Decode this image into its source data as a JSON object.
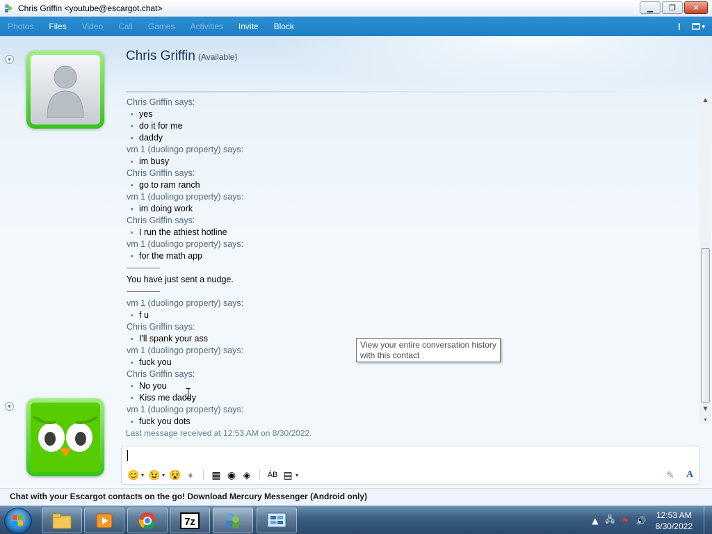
{
  "window": {
    "title": "Chris Griffin <youtube@escargot.chat>",
    "minimize_glyph": "▁",
    "maximize_glyph": "❐",
    "close_glyph": "✕"
  },
  "menu": {
    "items": [
      {
        "label": "Photos",
        "enabled": false
      },
      {
        "label": "Files",
        "enabled": true
      },
      {
        "label": "Video",
        "enabled": false
      },
      {
        "label": "Call",
        "enabled": false
      },
      {
        "label": "Games",
        "enabled": false
      },
      {
        "label": "Activities",
        "enabled": false
      },
      {
        "label": "Invite",
        "enabled": true
      },
      {
        "label": "Block",
        "enabled": true
      }
    ],
    "alert_glyph": "!",
    "options_glyph": "▾"
  },
  "contact": {
    "name": "Chris Griffin",
    "status": "(Available)"
  },
  "conversation": [
    {
      "sender": "Chris Griffin says:",
      "messages": [
        "yes",
        "do it for me",
        "daddy"
      ]
    },
    {
      "sender": "vm 1 (duolingo property) says:",
      "messages": [
        "im busy"
      ]
    },
    {
      "sender": "Chris Griffin says:",
      "messages": [
        "go to ram ranch"
      ]
    },
    {
      "sender": "vm 1 (duolingo property) says:",
      "messages": [
        "im doing work"
      ]
    },
    {
      "sender": "Chris Griffin says:",
      "messages": [
        "I run the athiest hotline"
      ]
    },
    {
      "sender": "vm 1 (duolingo property) says:",
      "messages": [
        "for the math app"
      ]
    }
  ],
  "nudge_text": "You have just sent a nudge.",
  "conversation_after": [
    {
      "sender": "vm 1 (duolingo property) says:",
      "messages": [
        "f u"
      ]
    },
    {
      "sender": "Chris Griffin says:",
      "messages": [
        "I'll spank your ass"
      ]
    },
    {
      "sender": "vm 1 (duolingo property) says:",
      "messages": [
        "fuck you"
      ]
    },
    {
      "sender": "Chris Griffin says:",
      "messages": [
        "No you",
        "Kiss me daddy"
      ]
    },
    {
      "sender": "vm 1 (duolingo property) says:",
      "messages": [
        "fuck you dots"
      ]
    }
  ],
  "last_received": "Last message received at 12:53 AM on 8/30/2022.",
  "tooltip": {
    "line1": "View your entire conversation history",
    "line2": "with this contact"
  },
  "ad": "Chat with your Escargot contacts on the go! Download Mercury Messenger (Android only)",
  "taskbar": {
    "time": "12:53 AM",
    "date": "8/30/2022"
  },
  "colors": {
    "menubar": "#2b8fd3",
    "avatar_frame": "#36c21b",
    "duolingo_green": "#58cc02"
  }
}
